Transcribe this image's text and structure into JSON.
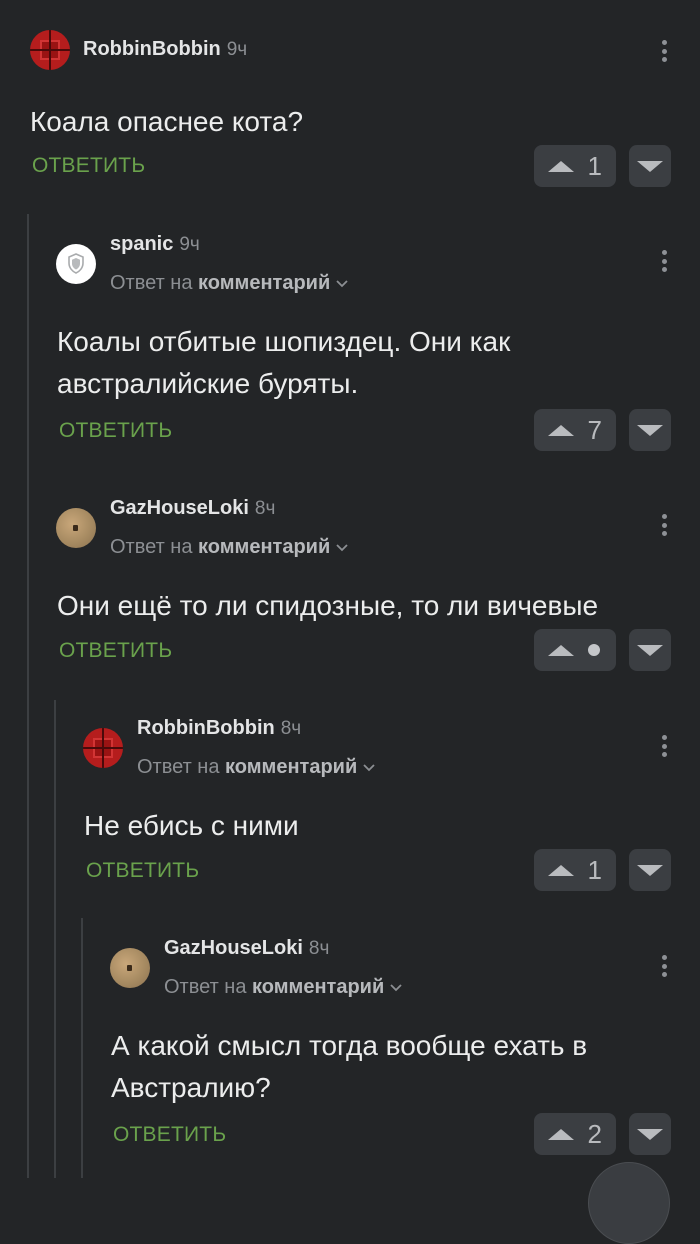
{
  "comments": [
    {
      "username": "RobbinBobbin",
      "time": "9ч",
      "text": "Коала опаснее кота?",
      "reply_label": "ОТВЕТИТЬ",
      "votes": "1",
      "avatar": "red-cube-avatar"
    },
    {
      "username": "spanic",
      "time": "9ч",
      "reply_prefix": "Ответ на",
      "reply_target": "комментарий",
      "text": "Коалы отбитые шопиздец. Они как австралийские буряты.",
      "reply_label": "ОТВЕТИТЬ",
      "votes": "7",
      "avatar": "shield-avatar"
    },
    {
      "username": "GazHouseLoki",
      "time": "8ч",
      "reply_prefix": "Ответ на",
      "reply_target": "комментарий",
      "text": "Они ещё то ли спидозные, то ли вичевые",
      "reply_label": "ОТВЕТИТЬ",
      "votes": "•",
      "avatar": "sand-avatar"
    },
    {
      "username": "RobbinBobbin",
      "time": "8ч",
      "reply_prefix": "Ответ на",
      "reply_target": "комментарий",
      "text": "Не ебись с ними",
      "reply_label": "ОТВЕТИТЬ",
      "votes": "1",
      "avatar": "red-cube-avatar"
    },
    {
      "username": "GazHouseLoki",
      "time": "8ч",
      "reply_prefix": "Ответ на",
      "reply_target": "комментарий",
      "text": "А какой смысл тогда вообще ехать в Австралию?",
      "reply_label": "ОТВЕТИТЬ",
      "votes": "2",
      "avatar": "sand-avatar"
    }
  ],
  "colors": {
    "background": "#232527",
    "reply_green": "#6aa24c",
    "vote_button": "#3b3e42",
    "thread_line": "#3c3f42"
  }
}
